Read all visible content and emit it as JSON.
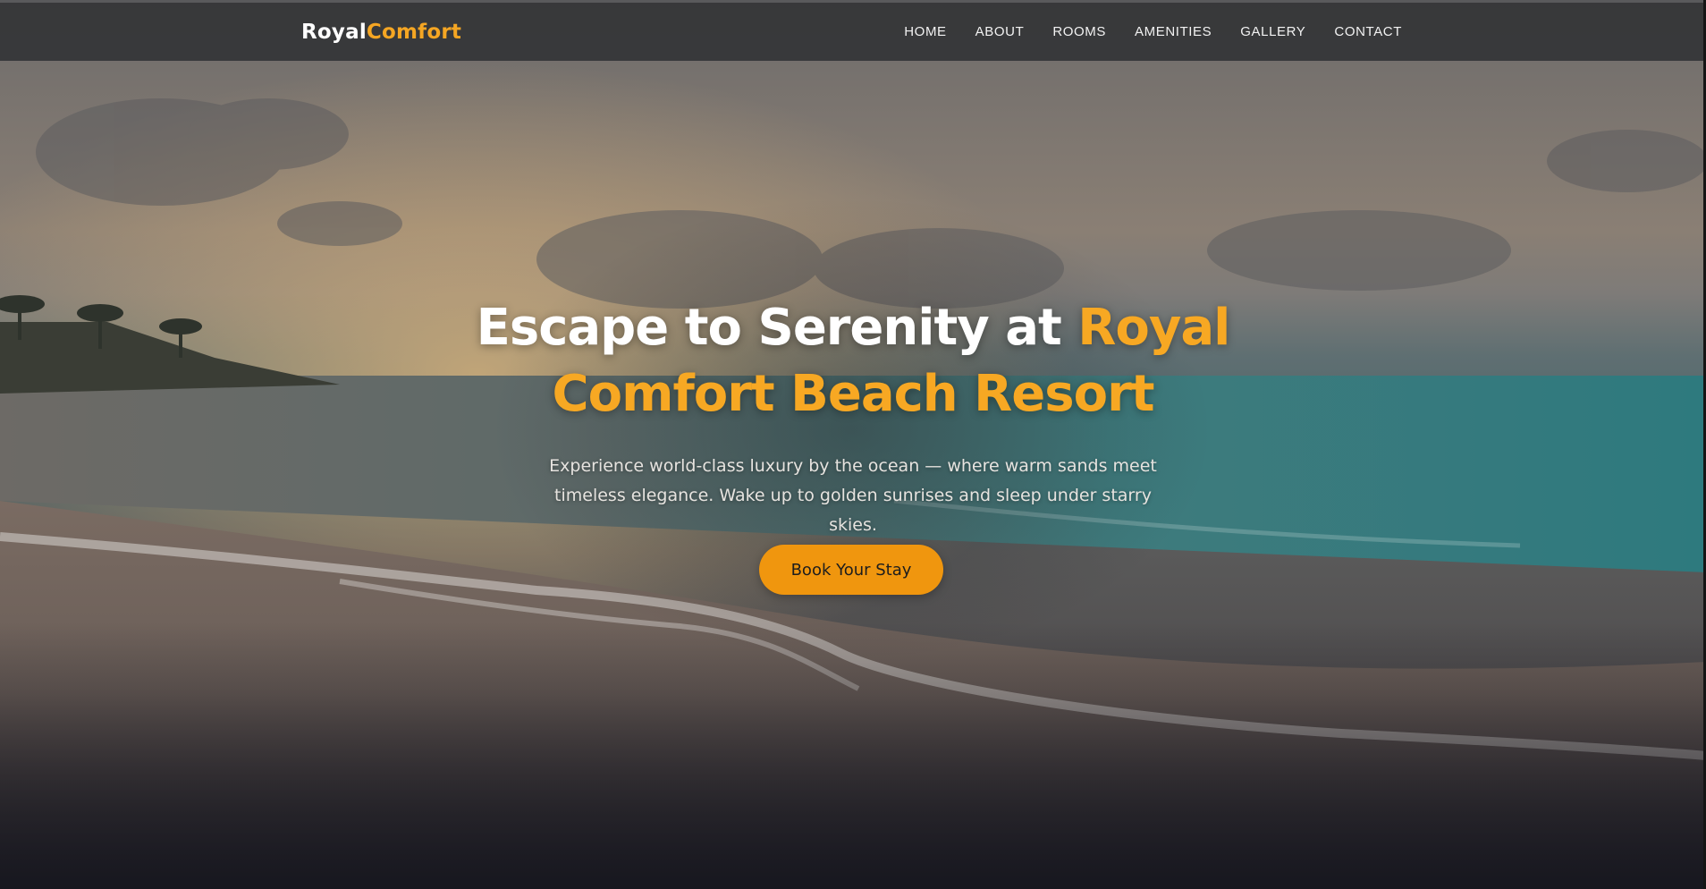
{
  "brand": {
    "part1": "Royal",
    "part2": "Comfort"
  },
  "nav": {
    "items": [
      {
        "label": "HOME"
      },
      {
        "label": "ABOUT"
      },
      {
        "label": "ROOMS"
      },
      {
        "label": "AMENITIES"
      },
      {
        "label": "GALLERY"
      },
      {
        "label": "CONTACT"
      }
    ]
  },
  "hero": {
    "headline_plain": "Escape to Serenity at ",
    "headline_accent": "Royal Comfort Beach Resort",
    "subtitle_line1": "Experience world-class luxury by the ocean — where warm sands meet",
    "subtitle_line2": "timeless elegance. Wake up to golden sunrises and sleep under starry skies.",
    "cta_label": "Book Your Stay"
  },
  "colors": {
    "accent": "#f7a823",
    "button": "#f0960e",
    "navbar": "#343537",
    "text_light": "#ffffff"
  }
}
